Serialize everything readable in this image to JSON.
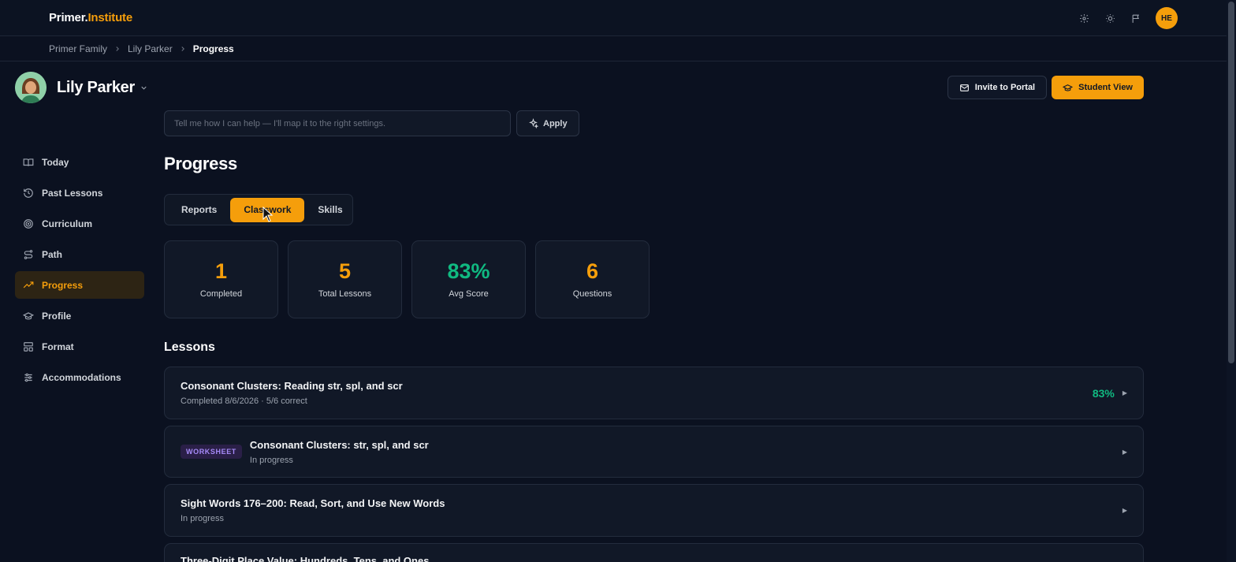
{
  "brand": {
    "part1": "Primer.",
    "part2": "Institute"
  },
  "header": {
    "user_initials": "HE"
  },
  "breadcrumb": {
    "items": [
      "Primer Family",
      "Lily Parker"
    ],
    "current": "Progress"
  },
  "student": {
    "name": "Lily Parker"
  },
  "actions": {
    "invite_label": "Invite to Portal",
    "student_view_label": "Student View"
  },
  "help": {
    "placeholder": "Tell me how I can help — I'll map it to the right settings.",
    "apply_label": "Apply"
  },
  "sidebar": {
    "items": [
      {
        "label": "Today",
        "icon": "book-open-icon"
      },
      {
        "label": "Past Lessons",
        "icon": "history-icon"
      },
      {
        "label": "Curriculum",
        "icon": "target-icon"
      },
      {
        "label": "Path",
        "icon": "route-icon"
      },
      {
        "label": "Progress",
        "icon": "trending-up-icon",
        "active": true
      },
      {
        "label": "Profile",
        "icon": "graduation-cap-icon"
      },
      {
        "label": "Format",
        "icon": "layout-icon"
      },
      {
        "label": "Accommodations",
        "icon": "sliders-icon"
      }
    ]
  },
  "page": {
    "title": "Progress"
  },
  "tabs": [
    {
      "label": "Reports"
    },
    {
      "label": "Classwork",
      "active": true
    },
    {
      "label": "Skills"
    }
  ],
  "stats": [
    {
      "value": "1",
      "label": "Completed",
      "color": "#f59e0b"
    },
    {
      "value": "5",
      "label": "Total Lessons",
      "color": "#f59e0b"
    },
    {
      "value": "83%",
      "label": "Avg Score",
      "color": "#10b981"
    },
    {
      "value": "6",
      "label": "Questions",
      "color": "#f59e0b"
    }
  ],
  "lessons_title": "Lessons",
  "lessons": [
    {
      "title": "Consonant Clusters: Reading str, spl, and scr",
      "subtitle": "Completed 8/6/2026 · 5/6 correct",
      "score": "83%"
    },
    {
      "badge": "WORKSHEET",
      "title": "Consonant Clusters: str, spl, and scr",
      "subtitle": "In progress"
    },
    {
      "title": "Sight Words 176–200: Read, Sort, and Use New Words",
      "subtitle": "In progress"
    },
    {
      "title": "Three-Digit Place Value: Hundreds, Tens, and Ones",
      "subtitle": ""
    }
  ],
  "colors": {
    "accent": "#f59e0b",
    "success": "#10b981",
    "background": "#0b1120"
  }
}
